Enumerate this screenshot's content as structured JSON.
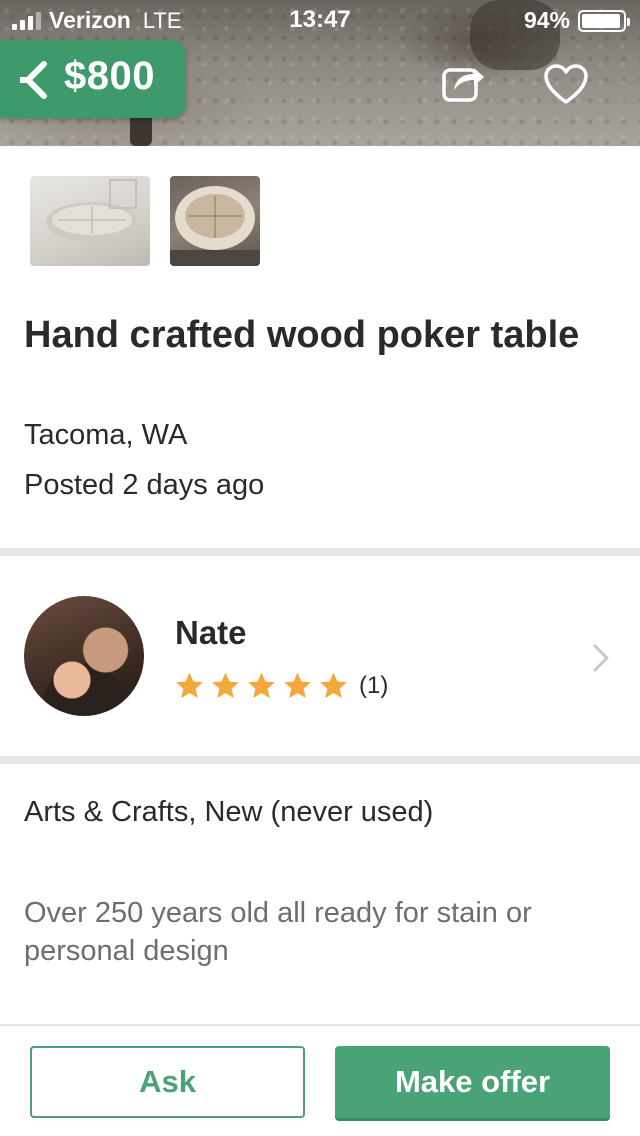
{
  "status_bar": {
    "carrier": "Verizon",
    "network": "LTE",
    "time": "13:47",
    "battery_percent": "94%",
    "battery_level": 0.94
  },
  "header": {
    "price": "$800",
    "back_icon": "chevron-left-icon",
    "share_icon": "share-icon",
    "favorite_icon": "heart-icon"
  },
  "listing": {
    "title": "Hand crafted wood poker table",
    "location": "Tacoma, WA",
    "posted": "Posted 2 days ago",
    "thumbnail_count": 2
  },
  "seller": {
    "name": "Nate",
    "rating_stars": 5,
    "rating_count": "(1)",
    "star_color": "#f2a93b"
  },
  "details": {
    "category": "Arts & Crafts, New (never used)",
    "description": "Over 250 years old all ready for stain or personal design"
  },
  "actions": {
    "ask_label": "Ask",
    "offer_label": "Make offer"
  },
  "colors": {
    "brand_green": "#4aa277",
    "price_tag_green": "#3f9a6b"
  }
}
